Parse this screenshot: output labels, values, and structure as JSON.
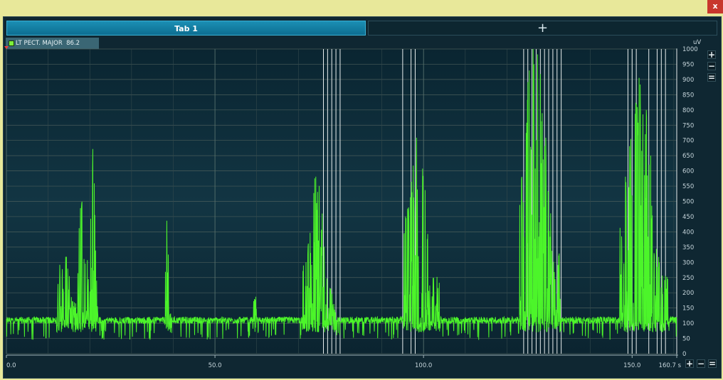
{
  "window": {
    "close_label": "x"
  },
  "tabs": [
    {
      "label": "Tab 1"
    }
  ],
  "add_tab_label": "+",
  "channel": {
    "name": "LT PECT. MAJOR",
    "value": "86.2",
    "color": "#7df03a"
  },
  "unit": "uV",
  "y_controls": {
    "zoom_in": "+",
    "zoom_out": "−",
    "fit": "="
  },
  "x_controls": {
    "zoom_in": "+",
    "zoom_out": "−",
    "fit": "="
  },
  "chart_data": {
    "type": "line",
    "title": "",
    "xlabel": "",
    "ylabel": "uV",
    "xlim": [
      0,
      160.7
    ],
    "ylim": [
      0,
      1000
    ],
    "x_tick_labels": [
      "0.0",
      "50.0",
      "100.0",
      "150.0",
      "160.7 s"
    ],
    "x_tick_values": [
      0,
      50,
      100,
      150,
      160.7
    ],
    "y_tick_values": [
      0,
      50,
      100,
      150,
      200,
      250,
      300,
      350,
      400,
      450,
      500,
      550,
      600,
      650,
      700,
      750,
      800,
      850,
      900,
      950,
      1000
    ],
    "grid": true,
    "series": [
      {
        "color": "#4cf52a",
        "baseline": 110,
        "bursts": [
          {
            "start": 12,
            "end": 17,
            "peak": 250
          },
          {
            "start": 17,
            "end": 20.5,
            "peak": 460
          },
          {
            "start": 20,
            "end": 22,
            "peak": 580
          },
          {
            "start": 38,
            "end": 39.5,
            "peak": 340
          },
          {
            "start": 59,
            "end": 60,
            "peak": 260
          },
          {
            "start": 71,
            "end": 79,
            "peak": 500
          },
          {
            "start": 95,
            "end": 104,
            "peak": 630
          },
          {
            "start": 123,
            "end": 133,
            "peak": 1000
          },
          {
            "start": 147,
            "end": 159,
            "peak": 810
          }
        ]
      }
    ],
    "markers": [
      76,
      77,
      78,
      79,
      80,
      95,
      97,
      98,
      124,
      125,
      126,
      127,
      128,
      129,
      130,
      131,
      132,
      133,
      149,
      150,
      151,
      154,
      156,
      157,
      158,
      161
    ]
  }
}
